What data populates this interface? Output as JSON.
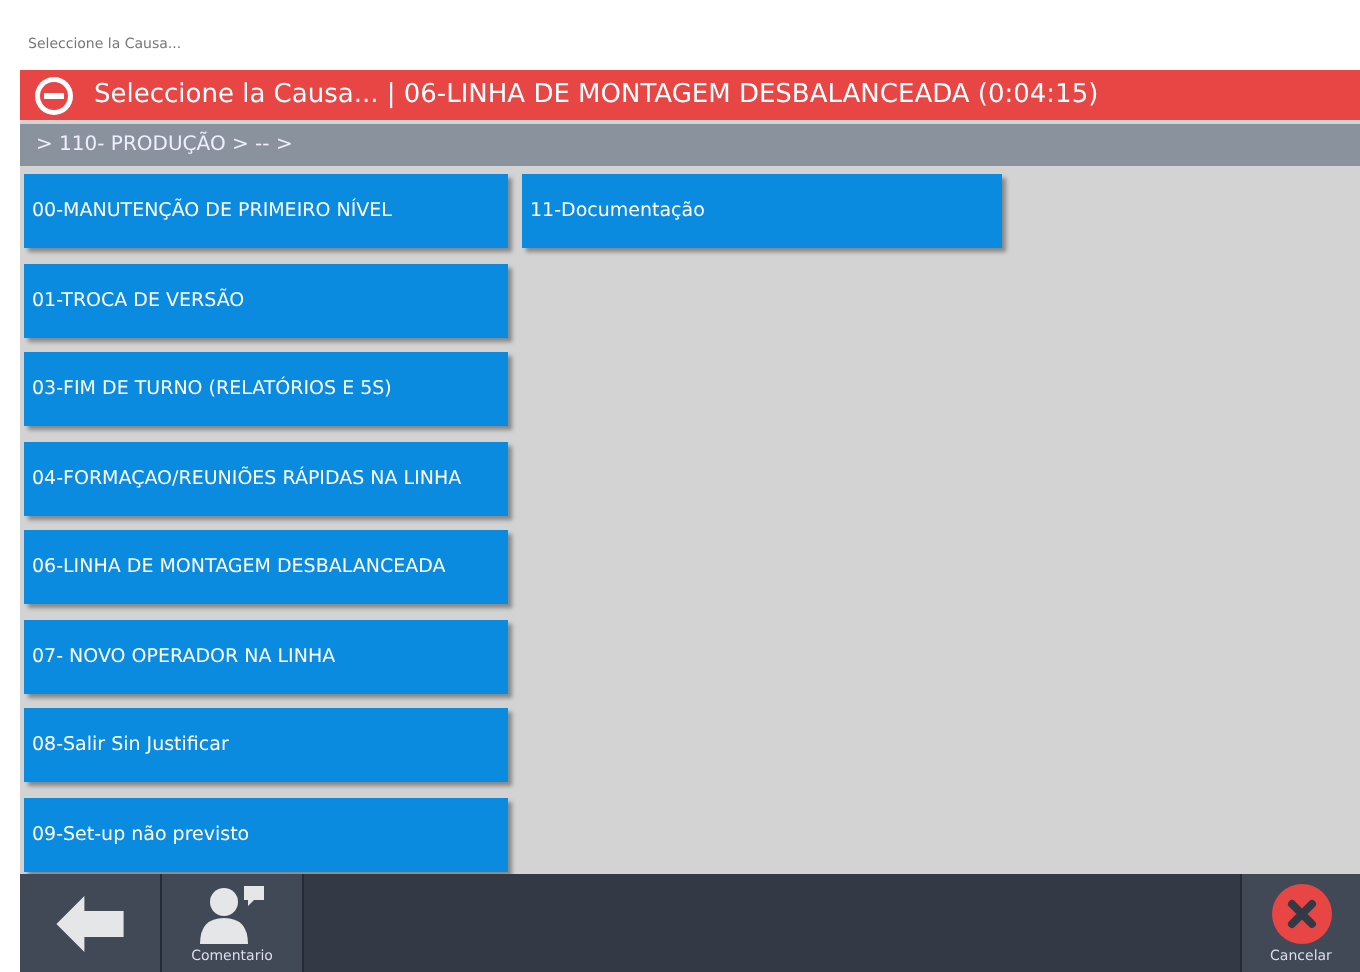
{
  "window": {
    "title": "Seleccione la Causa..."
  },
  "header": {
    "title": "Seleccione la Causa... | 06-LINHA DE MONTAGEM DESBALANCEADA (0:04:15)"
  },
  "breadcrumb": "> 110- PRODUÇÃO > -- >",
  "causes": [
    {
      "label": "00-MANUTENÇÃO DE PRIMEIRO NÍVEL"
    },
    {
      "label": "01-TROCA DE VERSÃO"
    },
    {
      "label": "03-FIM DE TURNO (RELATÓRIOS E 5S)"
    },
    {
      "label": "04-FORMAÇAO/REUNIÕES RÁPIDAS NA LINHA"
    },
    {
      "label": "06-LINHA DE MONTAGEM DESBALANCEADA"
    },
    {
      "label": "07- NOVO OPERADOR NA LINHA"
    },
    {
      "label": "08-Salir Sin Justificar"
    },
    {
      "label": "09-Set-up não previsto"
    },
    {
      "label": "11-Documentação"
    }
  ],
  "toolbar": {
    "comment_label": "Comentario",
    "cancel_label": "Cancelar"
  }
}
